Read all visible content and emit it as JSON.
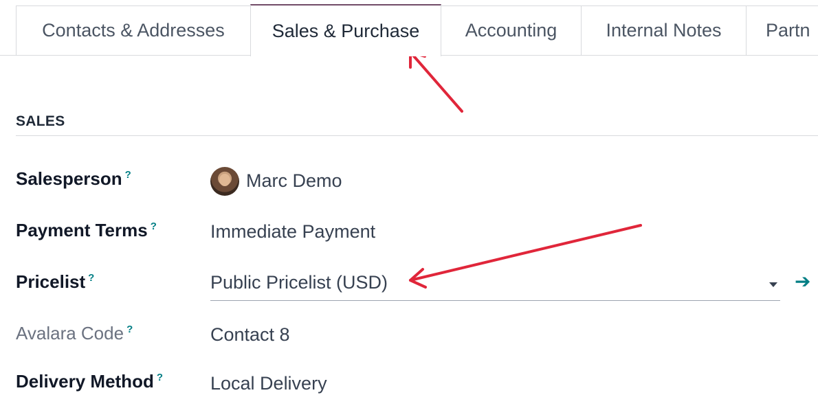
{
  "tabs": [
    {
      "label": "Contacts & Addresses",
      "active": false
    },
    {
      "label": "Sales & Purchase",
      "active": true
    },
    {
      "label": "Accounting",
      "active": false
    },
    {
      "label": "Internal Notes",
      "active": false
    },
    {
      "label": "Partn",
      "active": false
    }
  ],
  "section": {
    "title": "SALES"
  },
  "fields": {
    "salesperson": {
      "label": "Salesperson",
      "help": "?",
      "value": "Marc Demo"
    },
    "payment_terms": {
      "label": "Payment Terms",
      "help": "?",
      "value": "Immediate Payment"
    },
    "pricelist": {
      "label": "Pricelist",
      "help": "?",
      "value": "Public Pricelist (USD)"
    },
    "avalara_code": {
      "label": "Avalara Code",
      "help": "?",
      "value": "Contact 8"
    },
    "delivery_method": {
      "label": "Delivery Method",
      "help": "?",
      "value": "Local Delivery"
    }
  },
  "icons": {
    "dropdown": "caret-down-icon",
    "open_record": "arrow-right-icon",
    "avatar": "user-avatar"
  },
  "colors": {
    "annotation_arrow": "#e0263a",
    "accent": "#017e84",
    "active_tab_border": "#714b67"
  },
  "glyphs": {
    "open_arrow": "➔"
  }
}
